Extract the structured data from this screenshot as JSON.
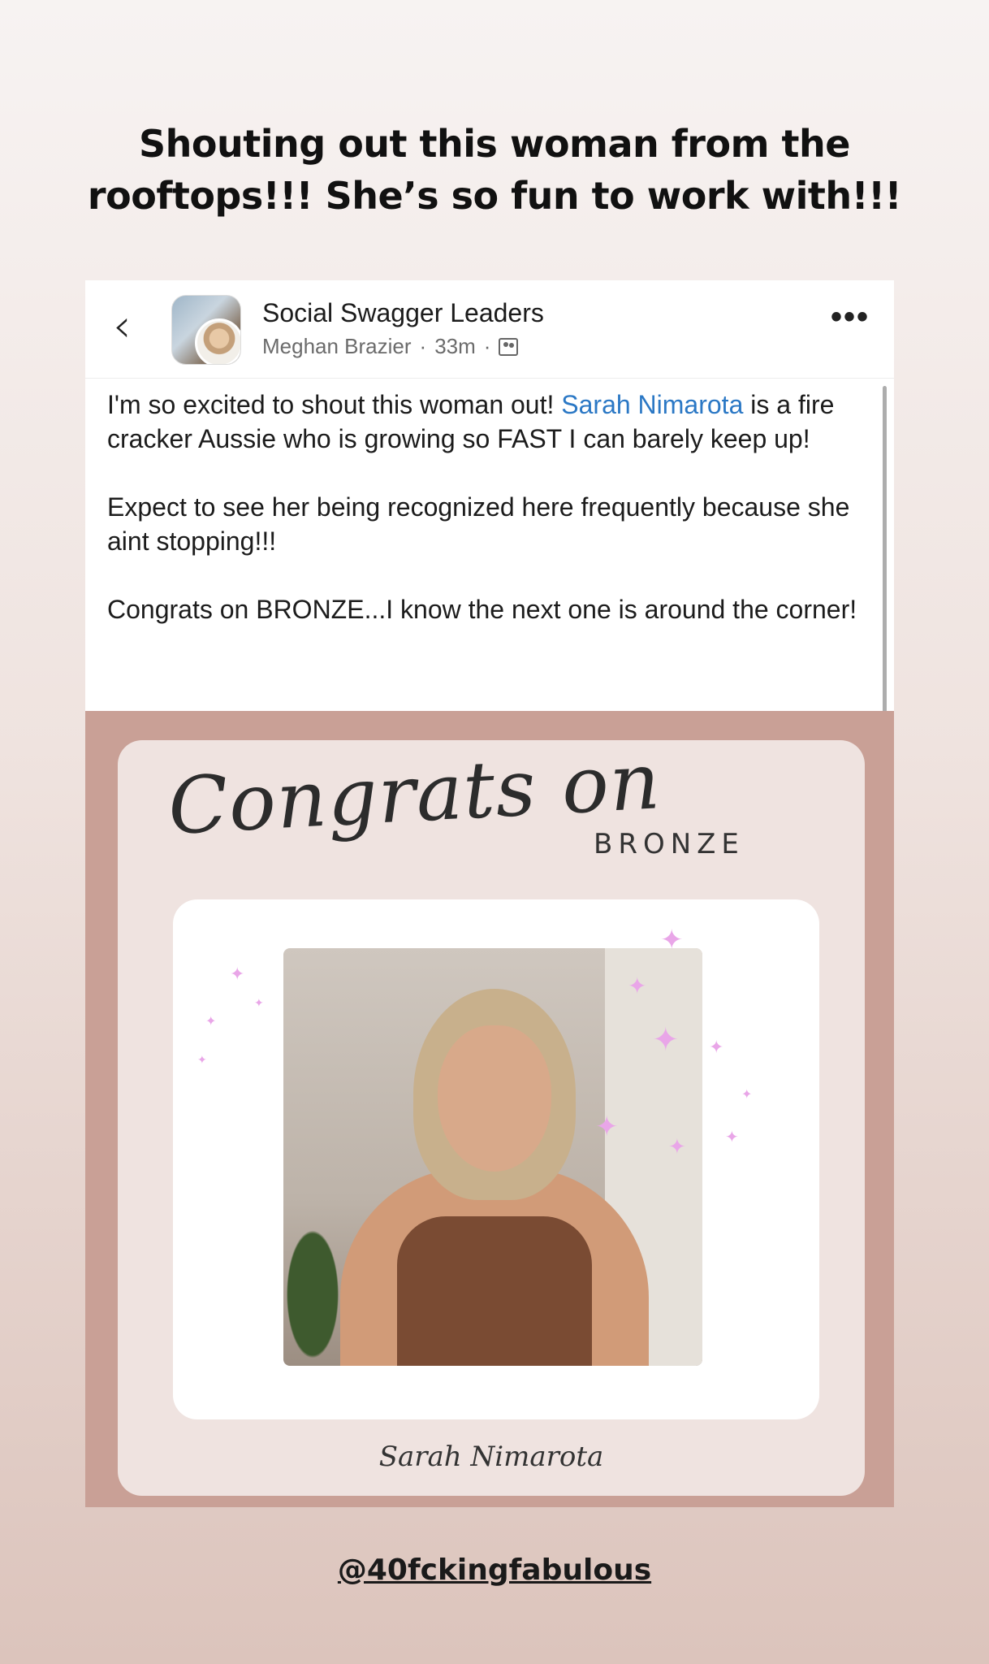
{
  "story": {
    "caption_line1": "Shouting out this woman from the",
    "caption_line2": "rooftops!!! She’s so fun to work with!!!",
    "handle": "@40fckingfabulous"
  },
  "post": {
    "back_icon": "chevron-left-icon",
    "group_name": "Social Swagger Leaders",
    "author": "Meghan Brazier",
    "time": "33m",
    "audience_icon": "group-icon",
    "more_icon": "more-horizontal-icon",
    "more_label": "•••",
    "body": {
      "p1_before": "I'm so excited to shout this woman out! ",
      "mention": "Sarah Nimarota",
      "p1_after": " is a fire cracker Aussie who is growing so FAST I can barely keep up!",
      "p2": "Expect to see her being recognized here frequently because she aint stopping!!!",
      "p3": "Congrats on BRONZE...I know the next one is around the corner!"
    }
  },
  "graphic": {
    "script_title": "Congrats on",
    "level": "BRONZE",
    "person_name": "Sarah Nimarota"
  },
  "colors": {
    "mention": "#2b78c5",
    "graphic_bg": "#c9a096",
    "inner_card": "#efe3e0",
    "sparkle": "#e9a6e8"
  }
}
